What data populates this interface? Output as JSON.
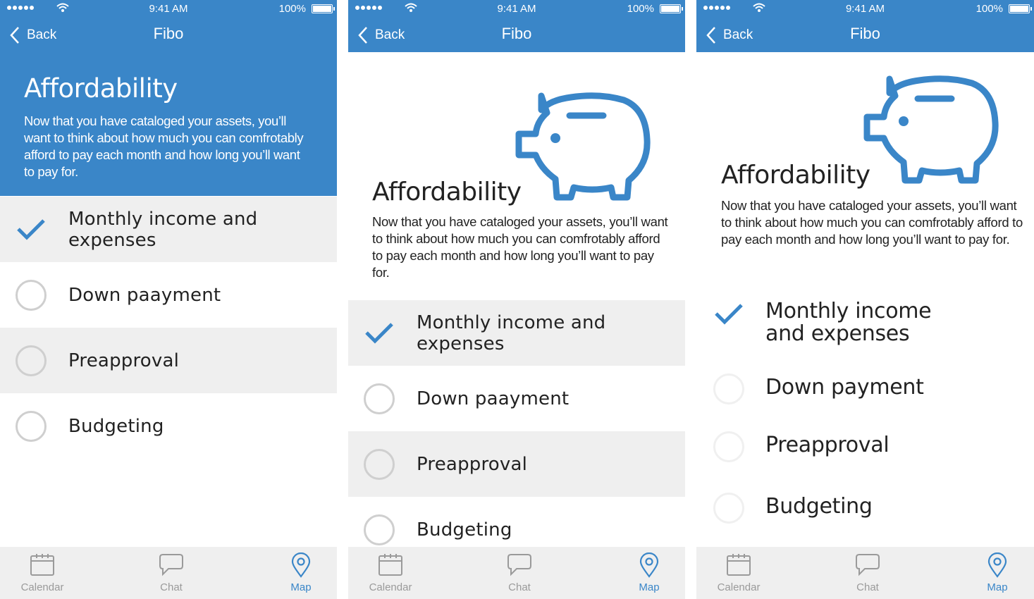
{
  "status": {
    "time": "9:41 AM",
    "battery": "100%"
  },
  "nav": {
    "back_label": "Back",
    "title": "Fibo"
  },
  "page": {
    "title": "Affordability",
    "description_s1": "Now that you have cataloged your assets, you’ll want to think about how much you can comfrotably afford to pay each month and how long you’ll  want to pay for.",
    "description_s2": "Now that you have cataloged your assets, you’ll want to think about how much you can comfrotably afford to pay each month and how long you’ll want to pay for.",
    "description_s3": "Now that you have cataloged your assets, you’ll want to think about how much you can comfrotably afford to pay each month and how long you’ll want to pay for."
  },
  "steps_v1": [
    {
      "label": "Monthly income and expenses",
      "done": true
    },
    {
      "label": "Down paayment",
      "done": false
    },
    {
      "label": "Preapproval",
      "done": false
    },
    {
      "label": "Budgeting",
      "done": false
    }
  ],
  "steps_v3": [
    {
      "label": "Monthly income and expenses",
      "done": true
    },
    {
      "label": "Down payment",
      "done": false
    },
    {
      "label": "Preapproval",
      "done": false
    },
    {
      "label": "Budgeting",
      "done": false
    }
  ],
  "tabs": [
    {
      "label": "Calendar",
      "icon": "calendar-icon",
      "active": false
    },
    {
      "label": "Chat",
      "icon": "chat-icon",
      "active": false
    },
    {
      "label": "Map",
      "icon": "map-pin-icon",
      "active": true
    }
  ],
  "colors": {
    "brand": "#3a86c8",
    "check": "#3a86c8",
    "row_shade": "#efefef",
    "tab_inactive": "#9a9a9a"
  }
}
